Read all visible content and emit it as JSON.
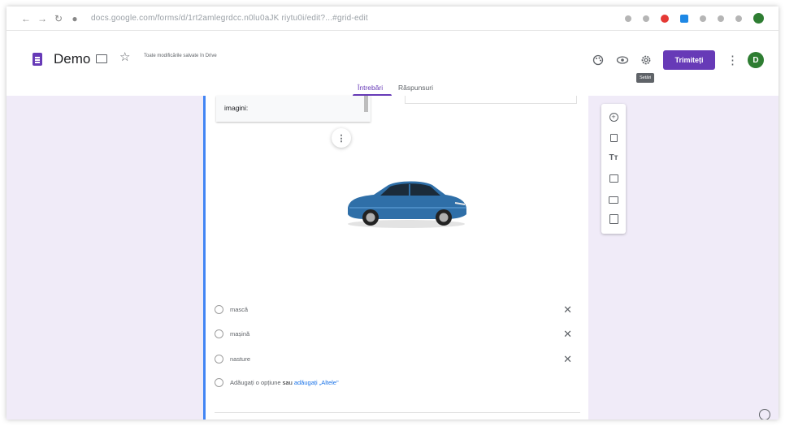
{
  "browser": {
    "url": "docs.google.com/forms/d/1rt2amlegrdcc.n0lu0aJK riytu0i/edit?...#grid-edit"
  },
  "header": {
    "doc_title": "Demo",
    "save_status": "Toate modificările salvate în Drive",
    "send_label": "Trimiteți",
    "avatar_letter": "D",
    "tooltip": "Setări"
  },
  "tabs": {
    "questions": "Întrebări",
    "responses": "Răspunsuri"
  },
  "question": {
    "text": "imagini:"
  },
  "options": [
    {
      "label": "mască"
    },
    {
      "label": "mașină"
    },
    {
      "label": "nasture"
    }
  ],
  "add_option": {
    "prefix": "Adăugați o opțiune",
    "or": "sau",
    "other": "adăugați „Altele\""
  },
  "colors": {
    "accent": "#673ab7",
    "card_accent": "#4285f4",
    "background": "#f0ebf8"
  },
  "icons": {
    "add_question": "add-circle-icon",
    "import": "import-icon",
    "title": "text-icon",
    "image": "image-icon",
    "video": "video-icon",
    "section": "section-icon"
  }
}
